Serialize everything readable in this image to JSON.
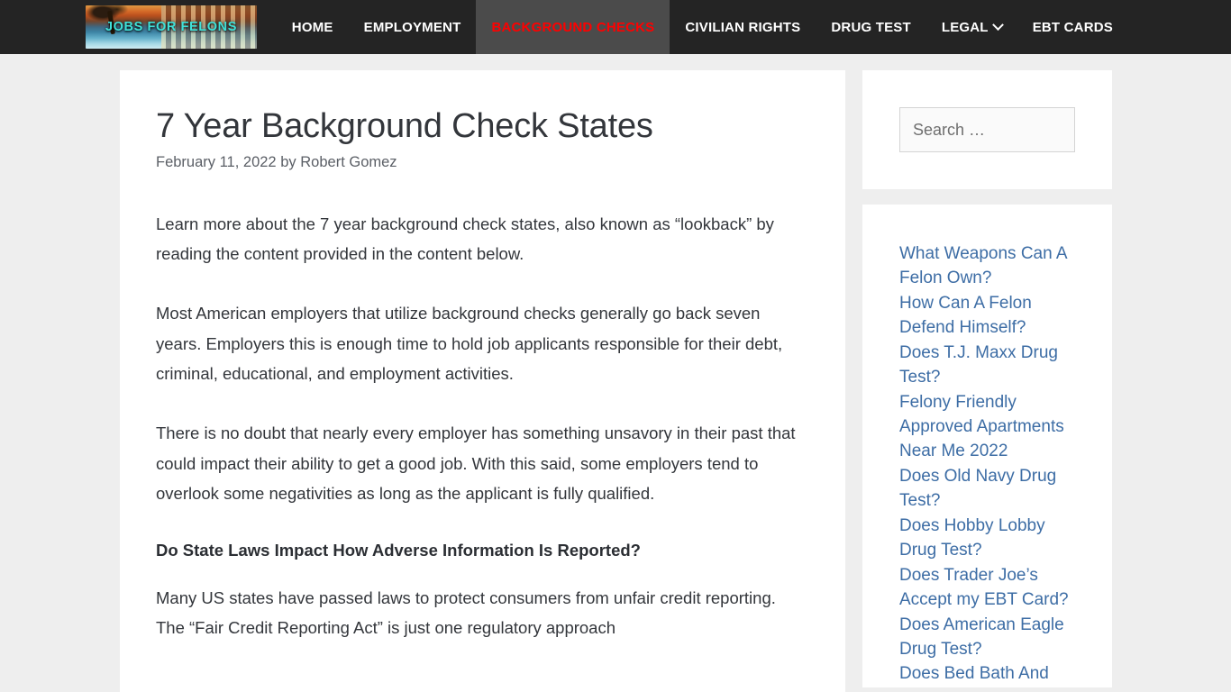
{
  "header": {
    "logo": {
      "brand_text": "JOBS FOR FELONS",
      "alt": "Jobs For Felons"
    },
    "nav": [
      {
        "label": "HOME",
        "active": false,
        "has_dropdown": false
      },
      {
        "label": "EMPLOYMENT",
        "active": false,
        "has_dropdown": false
      },
      {
        "label": "BACKGROUND CHECKS",
        "active": true,
        "has_dropdown": false
      },
      {
        "label": "CIVILIAN RIGHTS",
        "active": false,
        "has_dropdown": false
      },
      {
        "label": "DRUG TEST",
        "active": false,
        "has_dropdown": false
      },
      {
        "label": "LEGAL",
        "active": false,
        "has_dropdown": true
      },
      {
        "label": "EBT CARDS",
        "active": false,
        "has_dropdown": false
      }
    ],
    "colors": {
      "bar_background": "#242424",
      "active_background": "#4b4b4b",
      "active_text": "#ff0000",
      "text": "#ffffff"
    }
  },
  "article": {
    "title": "7 Year Background Check States",
    "date": "February 11, 2022",
    "by_label": "by",
    "author": "Robert Gomez",
    "paragraphs": [
      "Learn more about the 7 year background check states, also known as “lookback” by reading the content provided in the content below.",
      "Most American employers that utilize background checks generally go back seven years. Employers this is enough time to hold job applicants responsible for their debt, criminal, educational, and employment activities.",
      "There is no doubt that nearly every employer has something unsavory in their past that could impact their ability to get a good job. With this said, some employers tend to overlook some negativities as long as the applicant is fully qualified."
    ],
    "heading": "Do State Laws Impact How Adverse Information Is Reported?",
    "paragraph_after_heading": "Many US states have passed laws to protect consumers from unfair credit reporting. The “Fair Credit Reporting Act” is just one regulatory approach"
  },
  "sidebar": {
    "search": {
      "placeholder": "Search …",
      "value": ""
    },
    "recent_links": [
      "What Weapons Can A Felon Own?",
      "How Can A Felon Defend Himself?",
      "Does T.J. Maxx Drug Test?",
      "Felony Friendly Approved Apartments Near Me 2022",
      "Does Old Navy Drug Test?",
      "Does Hobby Lobby Drug Test?",
      "Does Trader Joe’s Accept my EBT Card?",
      "Does American Eagle Drug Test?",
      "Does Bed Bath And"
    ],
    "colors": {
      "link": "#3d6da5",
      "widget_background": "#ffffff"
    }
  },
  "page": {
    "background": "#eeeeee",
    "content_background": "#ffffff",
    "body_text_color": "#33363b"
  }
}
